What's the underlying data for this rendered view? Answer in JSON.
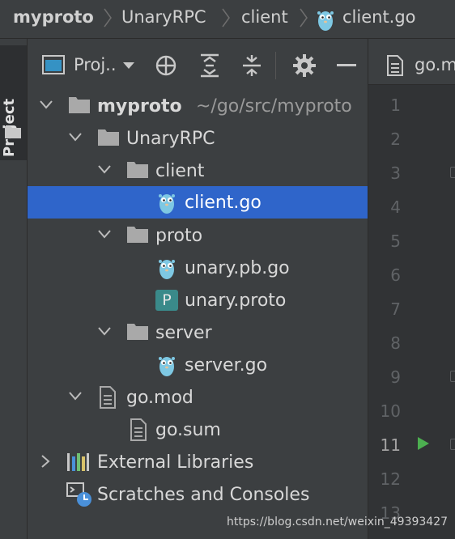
{
  "breadcrumb": {
    "items": [
      "myproto",
      "UnaryRPC",
      "client",
      "client.go"
    ]
  },
  "sidebar_strip": {
    "label": "Project"
  },
  "project_toolbar": {
    "title": "Proj..",
    "icons": [
      "dropdown-arrow",
      "locate-target",
      "expand-all",
      "collapse-all",
      "settings-gear",
      "hide-minus"
    ]
  },
  "tree": {
    "root": {
      "name": "myproto",
      "path": "~/go/src/myproto"
    },
    "unary": "UnaryRPC",
    "client_dir": "client",
    "client_go": "client.go",
    "proto_dir": "proto",
    "unary_pb_go": "unary.pb.go",
    "unary_proto": "unary.proto",
    "proto_badge": "P",
    "server_dir": "server",
    "server_go": "server.go",
    "go_mod": "go.mod",
    "go_sum": "go.sum",
    "external_libraries": "External Libraries",
    "scratches": "Scratches and Consoles"
  },
  "editor": {
    "tab_label": "go.m",
    "line_numbers": [
      "1",
      "2",
      "3",
      "4",
      "5",
      "6",
      "7",
      "8",
      "9",
      "10",
      "11",
      "12",
      "13"
    ],
    "current_line": "11"
  },
  "colors": {
    "background": "#3c3f41",
    "selection": "#2f65ca",
    "gopher": "#7ec8e3",
    "proto_badge": "#3a8a8a",
    "run_arrow": "#4caf50"
  },
  "watermark": "https://blog.csdn.net/weixin_49393427"
}
